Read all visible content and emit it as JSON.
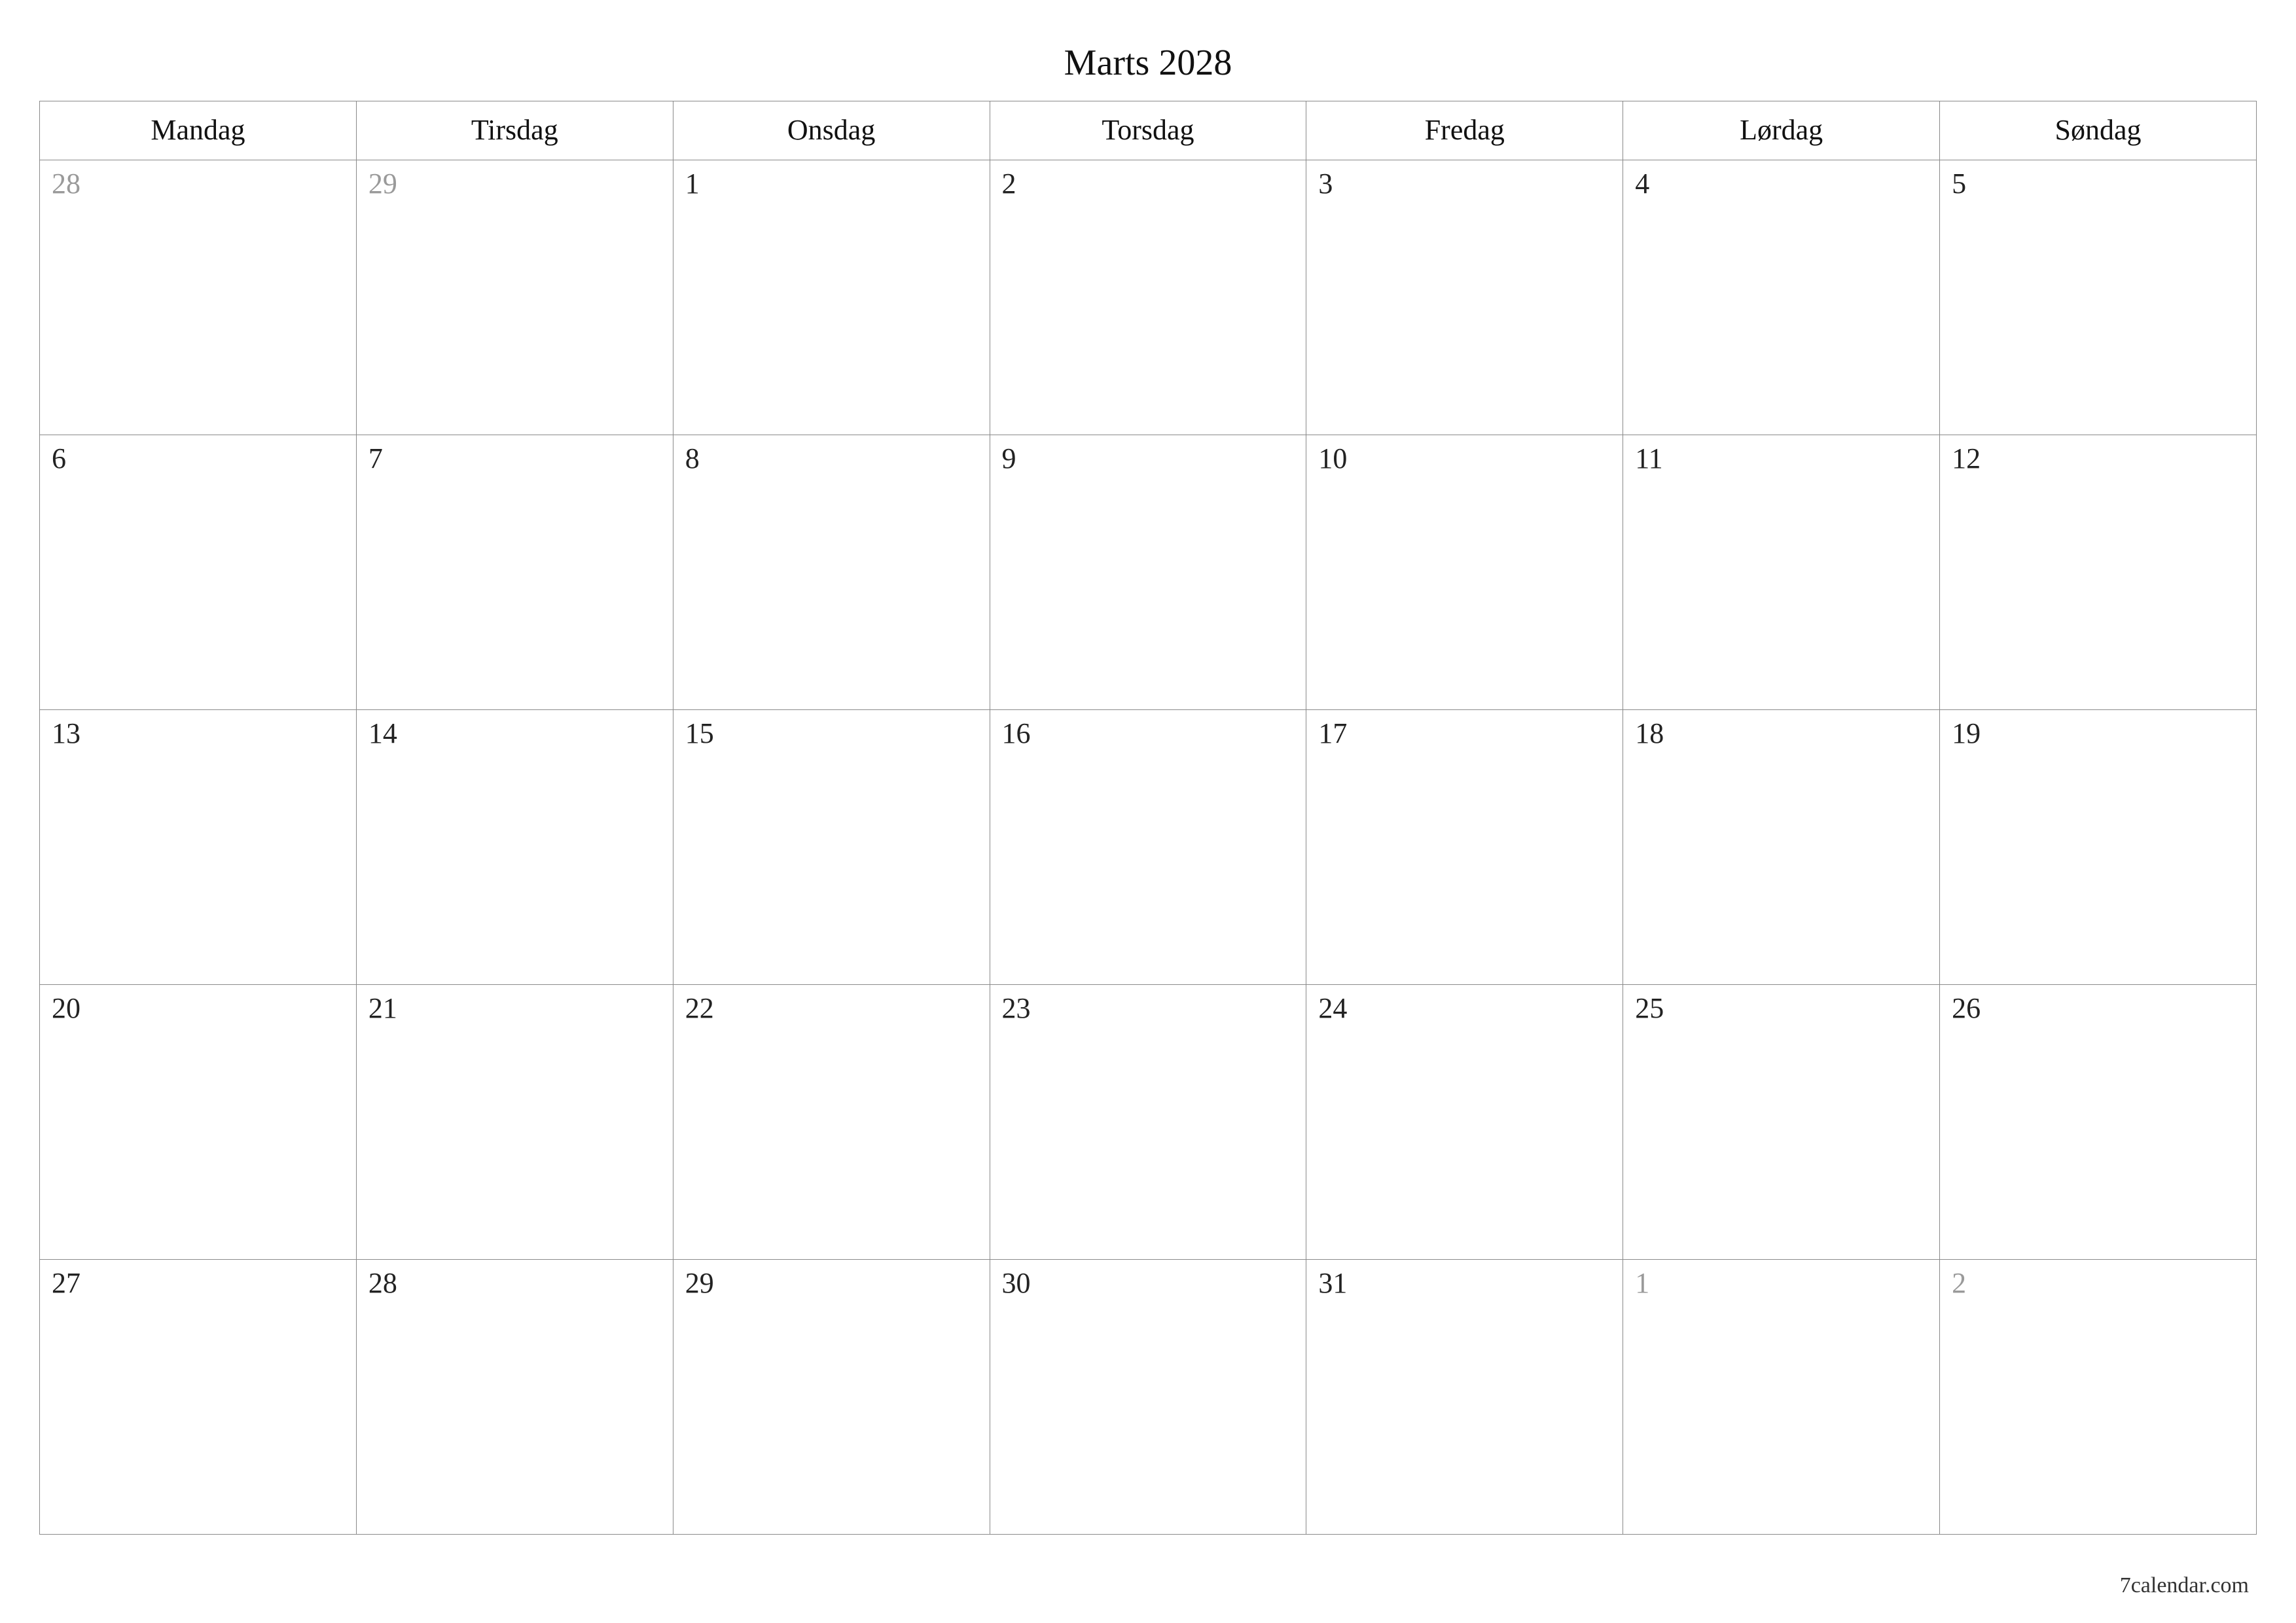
{
  "title": "Marts 2028",
  "weekdays": [
    "Mandag",
    "Tirsdag",
    "Onsdag",
    "Torsdag",
    "Fredag",
    "Lørdag",
    "Søndag"
  ],
  "weeks": [
    [
      {
        "n": "28",
        "outside": true
      },
      {
        "n": "29",
        "outside": true
      },
      {
        "n": "1",
        "outside": false
      },
      {
        "n": "2",
        "outside": false
      },
      {
        "n": "3",
        "outside": false
      },
      {
        "n": "4",
        "outside": false
      },
      {
        "n": "5",
        "outside": false
      }
    ],
    [
      {
        "n": "6",
        "outside": false
      },
      {
        "n": "7",
        "outside": false
      },
      {
        "n": "8",
        "outside": false
      },
      {
        "n": "9",
        "outside": false
      },
      {
        "n": "10",
        "outside": false
      },
      {
        "n": "11",
        "outside": false
      },
      {
        "n": "12",
        "outside": false
      }
    ],
    [
      {
        "n": "13",
        "outside": false
      },
      {
        "n": "14",
        "outside": false
      },
      {
        "n": "15",
        "outside": false
      },
      {
        "n": "16",
        "outside": false
      },
      {
        "n": "17",
        "outside": false
      },
      {
        "n": "18",
        "outside": false
      },
      {
        "n": "19",
        "outside": false
      }
    ],
    [
      {
        "n": "20",
        "outside": false
      },
      {
        "n": "21",
        "outside": false
      },
      {
        "n": "22",
        "outside": false
      },
      {
        "n": "23",
        "outside": false
      },
      {
        "n": "24",
        "outside": false
      },
      {
        "n": "25",
        "outside": false
      },
      {
        "n": "26",
        "outside": false
      }
    ],
    [
      {
        "n": "27",
        "outside": false
      },
      {
        "n": "28",
        "outside": false
      },
      {
        "n": "29",
        "outside": false
      },
      {
        "n": "30",
        "outside": false
      },
      {
        "n": "31",
        "outside": false
      },
      {
        "n": "1",
        "outside": true
      },
      {
        "n": "2",
        "outside": true
      }
    ]
  ],
  "footer": "7calendar.com"
}
